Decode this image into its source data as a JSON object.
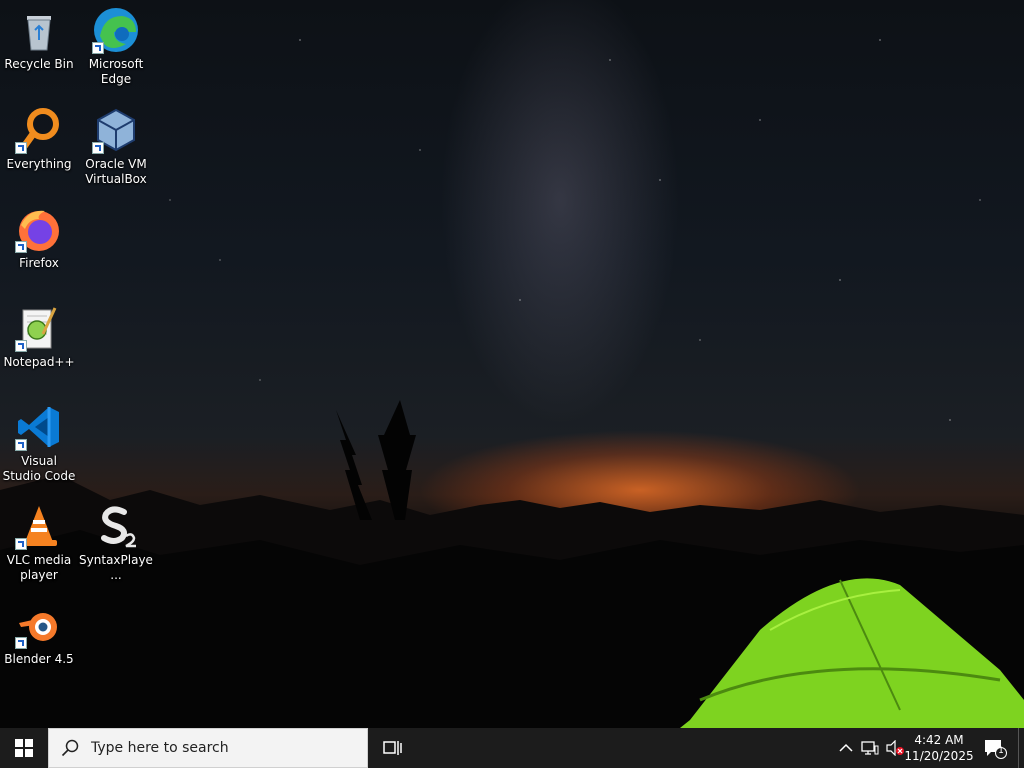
{
  "desktop": {
    "icons": [
      {
        "label": "Recycle Bin",
        "icon": "recycle-bin-icon"
      },
      {
        "label": "Microsoft Edge",
        "icon": "edge-icon"
      },
      {
        "label": "Everything",
        "icon": "everything-search-icon"
      },
      {
        "label": "Oracle VM VirtualBox",
        "icon": "virtualbox-icon"
      },
      {
        "label": "Firefox",
        "icon": "firefox-icon"
      },
      {
        "label": "Notepad++",
        "icon": "notepad-plus-plus-icon"
      },
      {
        "label": "Visual Studio Code",
        "icon": "vscode-icon"
      },
      {
        "label": "VLC media player",
        "icon": "vlc-icon"
      },
      {
        "label": "SyntaxPlaye...",
        "icon": "syntaxplayer-icon"
      },
      {
        "label": "Blender 4.5",
        "icon": "blender-icon"
      }
    ]
  },
  "taskbar": {
    "search_placeholder": "Type here to search",
    "clock": {
      "time": "4:42 AM",
      "date": "11/20/2025"
    },
    "notification_count": "1"
  },
  "colors": {
    "taskbar_bg": "#1c1c1c",
    "tent_green": "#7ed320",
    "sunset_orange": "#ff7a28"
  }
}
